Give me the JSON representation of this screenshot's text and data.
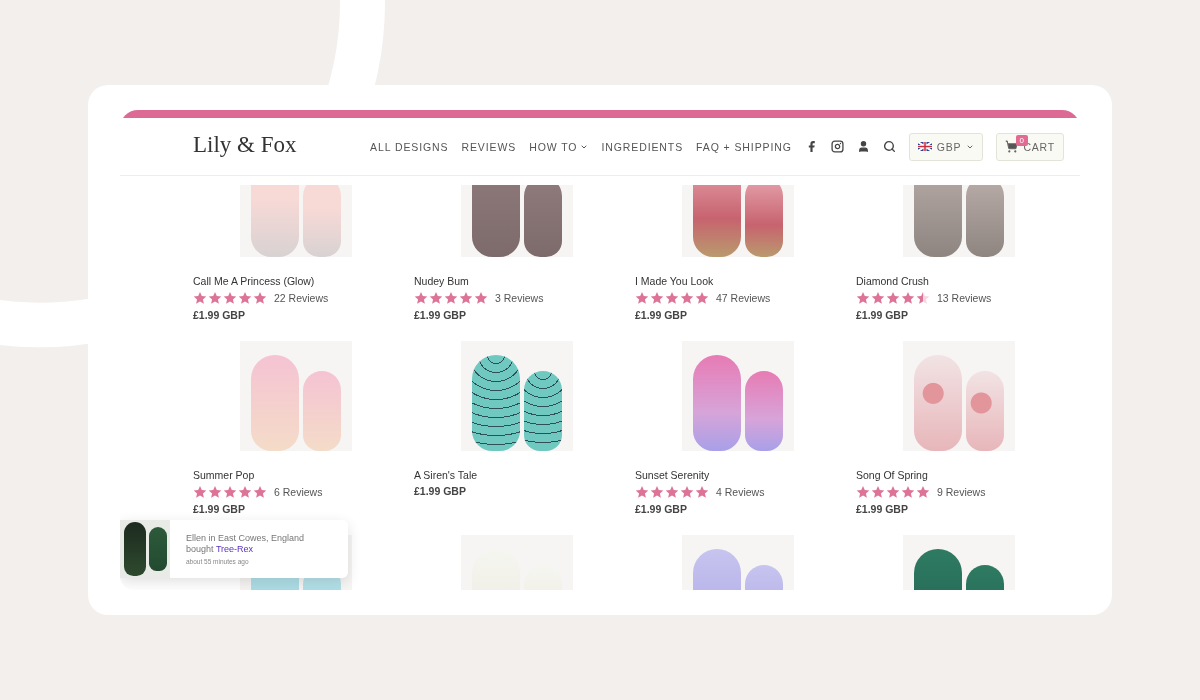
{
  "header": {
    "logo": "Lily & Fox",
    "nav": [
      {
        "label": "ALL DESIGNS",
        "dropdown": false
      },
      {
        "label": "REVIEWS",
        "dropdown": false
      },
      {
        "label": "HOW TO",
        "dropdown": true
      },
      {
        "label": "INGREDIENTS",
        "dropdown": false
      },
      {
        "label": "FAQ + SHIPPING",
        "dropdown": false
      }
    ],
    "currency": "GBP",
    "cart": {
      "label": "CART",
      "count": "0"
    }
  },
  "products": [
    {
      "kind": "listing",
      "name": "Call Me A Princess (Glow)",
      "stars": 5,
      "reviews": "22 Reviews",
      "price": "£1.99 GBP"
    },
    {
      "kind": "listing",
      "name": "Nudey Bum",
      "stars": 5,
      "reviews": "3 Reviews",
      "price": "£1.99 GBP"
    },
    {
      "kind": "listing",
      "name": "I Made You Look",
      "stars": 5,
      "reviews": "47 Reviews",
      "price": "£1.99 GBP"
    },
    {
      "kind": "listing",
      "name": "Diamond Crush",
      "stars": 4.5,
      "reviews": "13 Reviews",
      "price": "£1.99 GBP"
    },
    {
      "kind": "listing",
      "name": "Summer Pop",
      "stars": 5,
      "reviews": "6 Reviews",
      "price": "£1.99 GBP"
    },
    {
      "kind": "listing",
      "name": "A Siren's Tale",
      "price": "£1.99 GBP"
    },
    {
      "kind": "listing",
      "name": "Sunset Serenity",
      "stars": 5,
      "reviews": "4 Reviews",
      "price": "£1.99 GBP"
    },
    {
      "kind": "listing",
      "name": "Song Of Spring",
      "stars": 5,
      "reviews": "9 Reviews",
      "price": "£1.99 GBP"
    },
    {
      "kind": "image_only"
    },
    {
      "kind": "image_only"
    },
    {
      "kind": "image_only"
    },
    {
      "kind": "image_only"
    }
  ],
  "toast": {
    "message": "Ellen in East Cowes, England bought",
    "link": "Tree-Rex",
    "time": "about 55 minutes ago"
  }
}
